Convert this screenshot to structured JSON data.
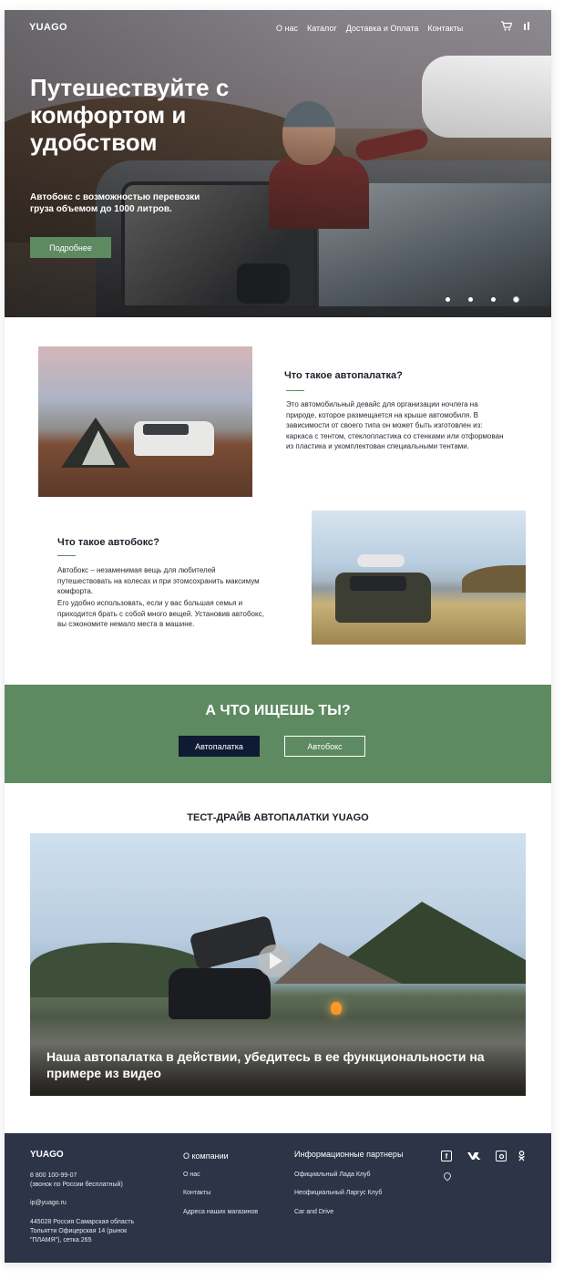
{
  "header": {
    "logo": "YUAGO",
    "nav": [
      "О нас",
      "Каталог",
      "Доставка и Оплата",
      "Контакты"
    ],
    "icons": [
      "cart-icon",
      "bar-icon"
    ]
  },
  "hero": {
    "title": "Путешествуйте с комфортом и удобством",
    "subtitle": "Автобокс с возможностью перевозки груза объемом до 1000 литров.",
    "button": "Подробнее",
    "slides": 4,
    "active_slide": 4
  },
  "section_tent": {
    "title": "Что такое автопалатка?",
    "text": "Это автомобильный девайс для организации ночлега на природе, которое размещается на крыше автомобиля. В зависимости от своего типа он может быть  изготовлен из: каркаса с тентом, стеклопластика со стенками или отформован из пластика и укомплектован специальными тентами."
  },
  "section_box": {
    "title": "Что такое автобокс?",
    "text1": "Автобокс – незаменимая вещь для любителей путешествовать на колесах и при этомсохранить максимум комфорта.",
    "text2": "Его удобно использовать, если у вас большая семья и приходится брать с собой много вещей. Установив автобокс, вы сэкономите немало места в машине."
  },
  "banner": {
    "title": "А ЧТО ИЩЕШЬ ТЫ?",
    "btn_tent": "Автопалатка",
    "btn_box": "Автобокс"
  },
  "video": {
    "title": "ТЕСТ-ДРАЙВ АВТОПАЛАТКИ YUAGO",
    "caption": "Наша автопалатка в действии, убедитесь в ее функциональности на примере из видео"
  },
  "footer": {
    "logo": "YUAGO",
    "phone": "8 800 100-99-07",
    "phone_note": "(звонок по России бесплатный)",
    "email": "ip@yuago.ru",
    "address": "445028 Россия Самарская область Тольятти Офицерская 14 (рынок \"ПЛАМЯ\"), сетка 265",
    "company": {
      "title": "О компании",
      "links": [
        "О нас",
        "Контакты",
        "Адреса наших магазинов"
      ]
    },
    "partners": {
      "title": "Информационные партнеры",
      "links": [
        "Официальный Лада Клуб",
        "Неофициальный Ларгус Клуб",
        "Car and Drive"
      ]
    },
    "social": [
      "facebook-icon",
      "vk-icon",
      "instagram-icon",
      "odnoklassniki-icon"
    ]
  },
  "colors": {
    "accent_green": "#5d8a60",
    "dark_navy": "#0f1a33",
    "footer_bg": "#2d3447"
  }
}
